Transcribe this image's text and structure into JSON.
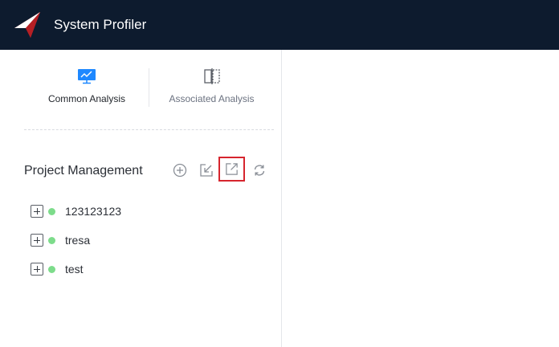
{
  "app": {
    "title": "System Profiler",
    "logo_icon": "red-arrow-logo",
    "header_bg": "#0d1b2e"
  },
  "analysis_tabs": [
    {
      "label": "Common Analysis",
      "icon": "monitor-chart-icon",
      "selected": true
    },
    {
      "label": "Associated Analysis",
      "icon": "split-compare-icon",
      "selected": false
    }
  ],
  "project_management": {
    "title": "Project Management",
    "tools": [
      {
        "name": "add",
        "icon": "add-circle-icon"
      },
      {
        "name": "import",
        "icon": "import-arrow-icon"
      },
      {
        "name": "export",
        "icon": "export-arrow-icon",
        "highlighted": true
      },
      {
        "name": "refresh",
        "icon": "refresh-icon"
      }
    ],
    "projects": [
      {
        "name": "123123123",
        "status_color": "#7ddc8b"
      },
      {
        "name": "tresa",
        "status_color": "#7ddc8b"
      },
      {
        "name": "test",
        "status_color": "#7ddc8b"
      }
    ]
  },
  "colors": {
    "accent": "#1e88ff",
    "highlight_border": "#d6252e",
    "status_ok": "#7ddc8b"
  }
}
